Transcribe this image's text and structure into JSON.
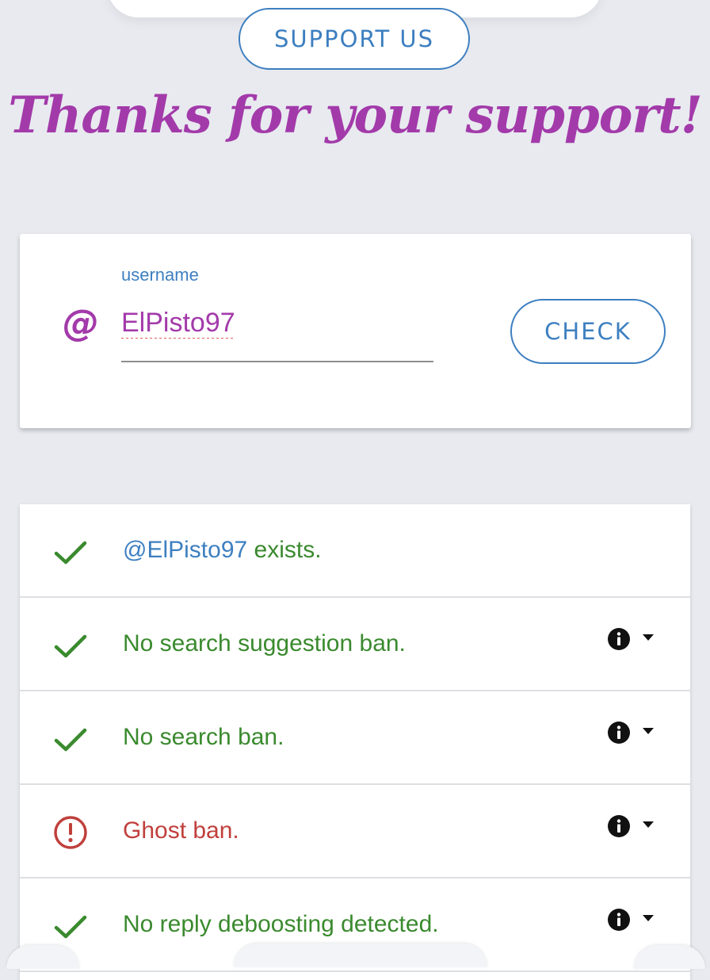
{
  "header": {
    "support_button_label": "SUPPORT US",
    "thanks_heading": "Thanks for your support!"
  },
  "search": {
    "at_symbol": "@",
    "field_label": "username",
    "username_value": "ElPisto97",
    "check_button_label": "CHECK"
  },
  "results": {
    "exists": {
      "mention": "@ElPisto97",
      "text": " exists.",
      "status": "ok",
      "icon": "check-icon"
    },
    "search_suggestion": {
      "text": "No search suggestion ban.",
      "status": "ok",
      "icon": "check-icon"
    },
    "search": {
      "text": "No search ban.",
      "status": "ok",
      "icon": "check-icon"
    },
    "ghost": {
      "text": "Ghost ban.",
      "status": "banned",
      "icon": "alert-circle-icon"
    },
    "reply_deboosting": {
      "text": "No reply deboosting detected.",
      "status": "ok",
      "icon": "check-icon"
    }
  },
  "colors": {
    "accent_blue": "#3d7fc0",
    "brand_purple": "#a33aaa",
    "ok_green": "#3a8a2e",
    "ban_red": "#c0403c",
    "background": "#e8eaef"
  }
}
